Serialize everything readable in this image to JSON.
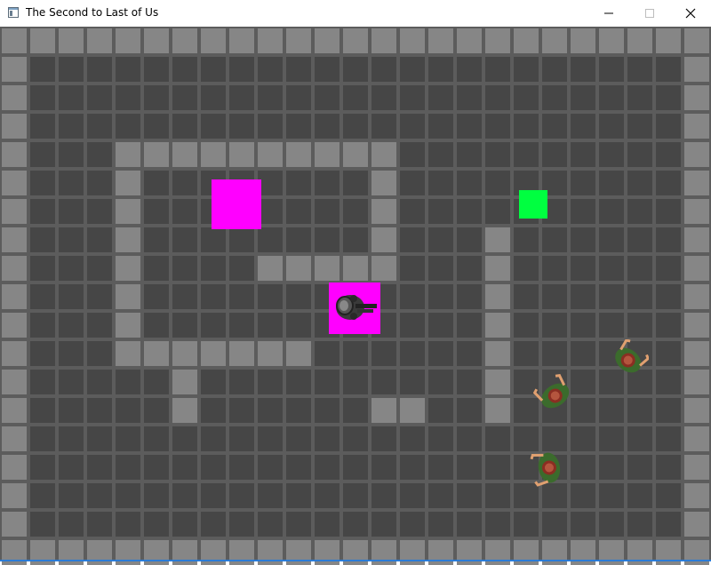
{
  "window": {
    "title": "The Second to Last of Us",
    "controls": [
      "minimize",
      "maximize",
      "close"
    ]
  },
  "game": {
    "grid": {
      "cols": 25,
      "rows": 19
    },
    "walls": [
      [
        4,
        4
      ],
      [
        5,
        4
      ],
      [
        6,
        4
      ],
      [
        7,
        4
      ],
      [
        8,
        4
      ],
      [
        9,
        4
      ],
      [
        10,
        4
      ],
      [
        11,
        4
      ],
      [
        12,
        4
      ],
      [
        13,
        4
      ],
      [
        4,
        5
      ],
      [
        4,
        6
      ],
      [
        4,
        7
      ],
      [
        4,
        8
      ],
      [
        4,
        9
      ],
      [
        4,
        10
      ],
      [
        4,
        11
      ],
      [
        13,
        5
      ],
      [
        13,
        6
      ],
      [
        13,
        7
      ],
      [
        13,
        8
      ],
      [
        9,
        8
      ],
      [
        10,
        8
      ],
      [
        11,
        8
      ],
      [
        12,
        8
      ],
      [
        5,
        11
      ],
      [
        6,
        11
      ],
      [
        7,
        11
      ],
      [
        8,
        11
      ],
      [
        9,
        11
      ],
      [
        10,
        11
      ],
      [
        6,
        12
      ],
      [
        6,
        13
      ],
      [
        13,
        13
      ],
      [
        14,
        13
      ],
      [
        17,
        7
      ],
      [
        17,
        8
      ],
      [
        17,
        9
      ],
      [
        17,
        10
      ],
      [
        17,
        11
      ],
      [
        17,
        12
      ],
      [
        17,
        13
      ]
    ],
    "items": [
      {
        "type": "pickup",
        "color": "#ff00ff"
      },
      {
        "type": "goal",
        "color": "#00ff40"
      }
    ],
    "player": {
      "name": "player",
      "highlight": "#ff00ff"
    },
    "zombies": [
      {
        "name": "zombie-1",
        "angle": 40
      },
      {
        "name": "zombie-2",
        "angle": -35
      },
      {
        "name": "zombie-3",
        "angle": -100
      }
    ]
  }
}
